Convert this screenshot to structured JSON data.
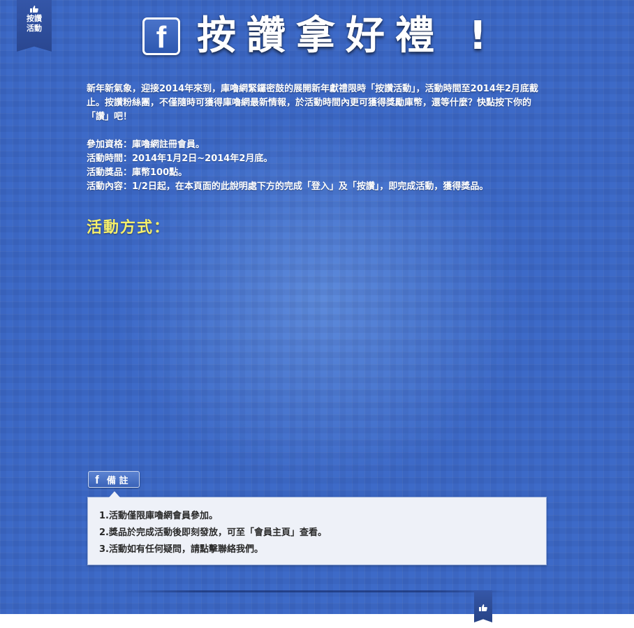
{
  "ribbon": {
    "line1": "按讚",
    "line2": "活動",
    "icon": "thumbs-up-icon"
  },
  "header": {
    "fb_letter": "f",
    "title": "按讚拿好禮 !"
  },
  "intro": {
    "paragraph": "新年新氣象，迎接2014年來到，庫嚕網緊鑼密鼓的展開新年獻禮限時「按讚活動」，活動時間至2014年2月底截止。按讚粉絲團，不僅隨時可獲得庫嚕網最新情報，於活動時間內更可獲得獎勵庫幣，還等什麼？快點按下你的「讚」吧！"
  },
  "details": {
    "eligibility": "參加資格：庫嚕網註冊會員。",
    "period": "活動時間：2014年1月2日~2014年2月底。",
    "prize": "活動獎品：庫幣100點。",
    "content": "活動內容：1/2日起，在本頁面的此說明處下方的完成「登入」及「按讚」，即完成活動，獲得獎品。"
  },
  "method": {
    "heading": "活動方式："
  },
  "notes": {
    "tab_label": "備 註",
    "fb_letter": "f",
    "items": [
      "1.活動僅限庫嚕網會員參加。",
      "2.獎品於完成活動後即刻發放，可至「會員主頁」查看。",
      "3.活動如有任何疑問，請點擊聯絡我們。"
    ]
  },
  "colors": {
    "background": "#3d6ac8",
    "heading_accent": "#f6ef6a",
    "notes_bg": "#eef1f8"
  }
}
